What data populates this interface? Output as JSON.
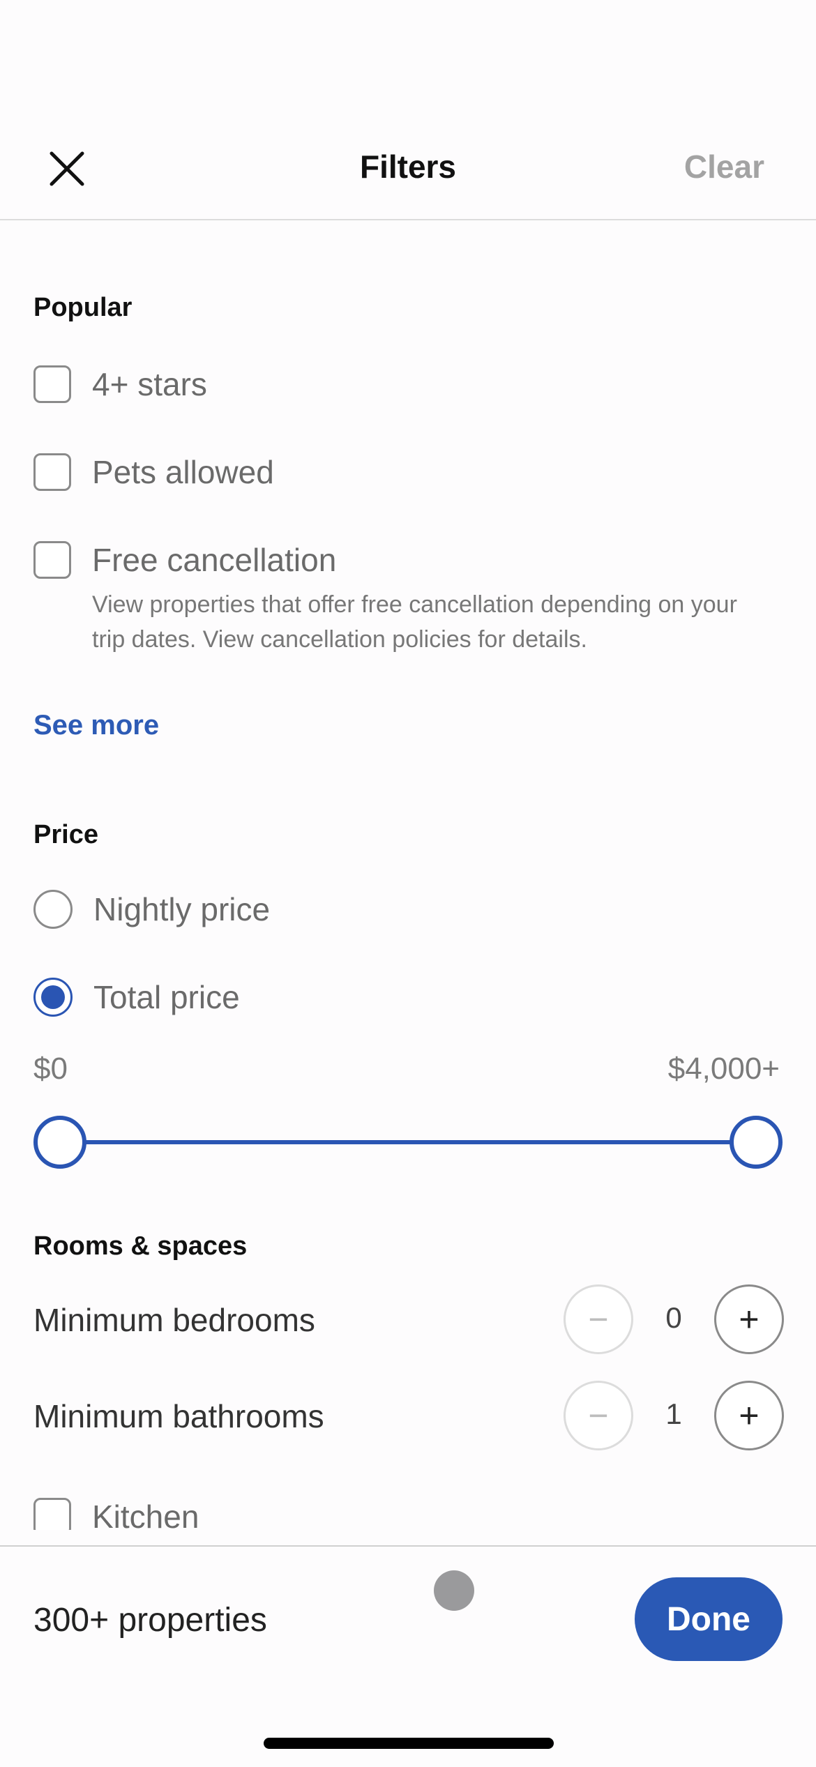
{
  "header": {
    "title": "Filters",
    "close_icon": "close-x-icon",
    "clear_label": "Clear"
  },
  "popular": {
    "title": "Popular",
    "options": [
      {
        "label": "4+ stars",
        "checked": false
      },
      {
        "label": "Pets allowed",
        "checked": false
      },
      {
        "label": "Free cancellation",
        "checked": false,
        "description": "View properties that offer free cancellation depending on your trip dates. View cancellation policies for details."
      }
    ],
    "see_more_label": "See more"
  },
  "price": {
    "title": "Price",
    "options": [
      {
        "label": "Nightly price",
        "selected": false
      },
      {
        "label": "Total price",
        "selected": true
      }
    ],
    "range": {
      "min_label": "$0",
      "max_label": "$4,000+",
      "min_value": 0,
      "max_value": 4000,
      "selected_low": 0,
      "selected_high": 4000
    }
  },
  "rooms": {
    "title": "Rooms & spaces",
    "steppers": [
      {
        "label": "Minimum bedrooms",
        "value": "0",
        "minus": "−",
        "plus": "+"
      },
      {
        "label": "Minimum bathrooms",
        "value": "1",
        "minus": "−",
        "plus": "+"
      }
    ],
    "amenities": [
      {
        "label": "Kitchen",
        "checked": false
      }
    ]
  },
  "footer": {
    "count_label": "300+ properties",
    "done_label": "Done"
  },
  "colors": {
    "accent": "#2a59b5",
    "link": "#2d5bb5",
    "disabled_text": "#a3a3a3"
  }
}
